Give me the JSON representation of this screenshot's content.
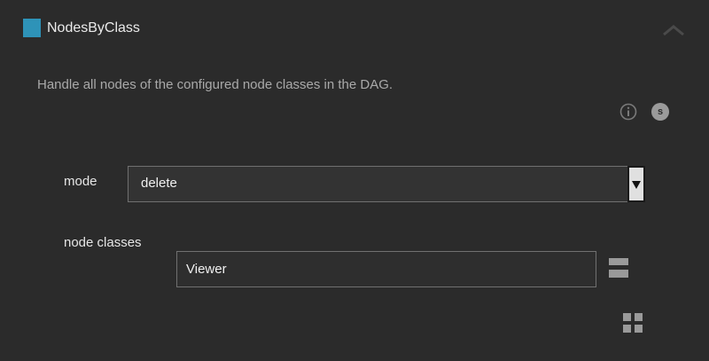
{
  "header": {
    "title": "NodesByClass",
    "swatch_color": "#2e93b8",
    "collapse_icon": "chevron-up-icon"
  },
  "description": "Handle all nodes of the configured node classes in the DAG.",
  "icons": {
    "info": "info-icon",
    "s_badge": "s"
  },
  "fields": {
    "mode": {
      "label": "mode",
      "value": "delete"
    },
    "node_classes": {
      "label": "node classes",
      "values": [
        "Viewer"
      ]
    }
  },
  "buttons": {
    "remove": "minus-icon",
    "add": "plus-icon"
  }
}
